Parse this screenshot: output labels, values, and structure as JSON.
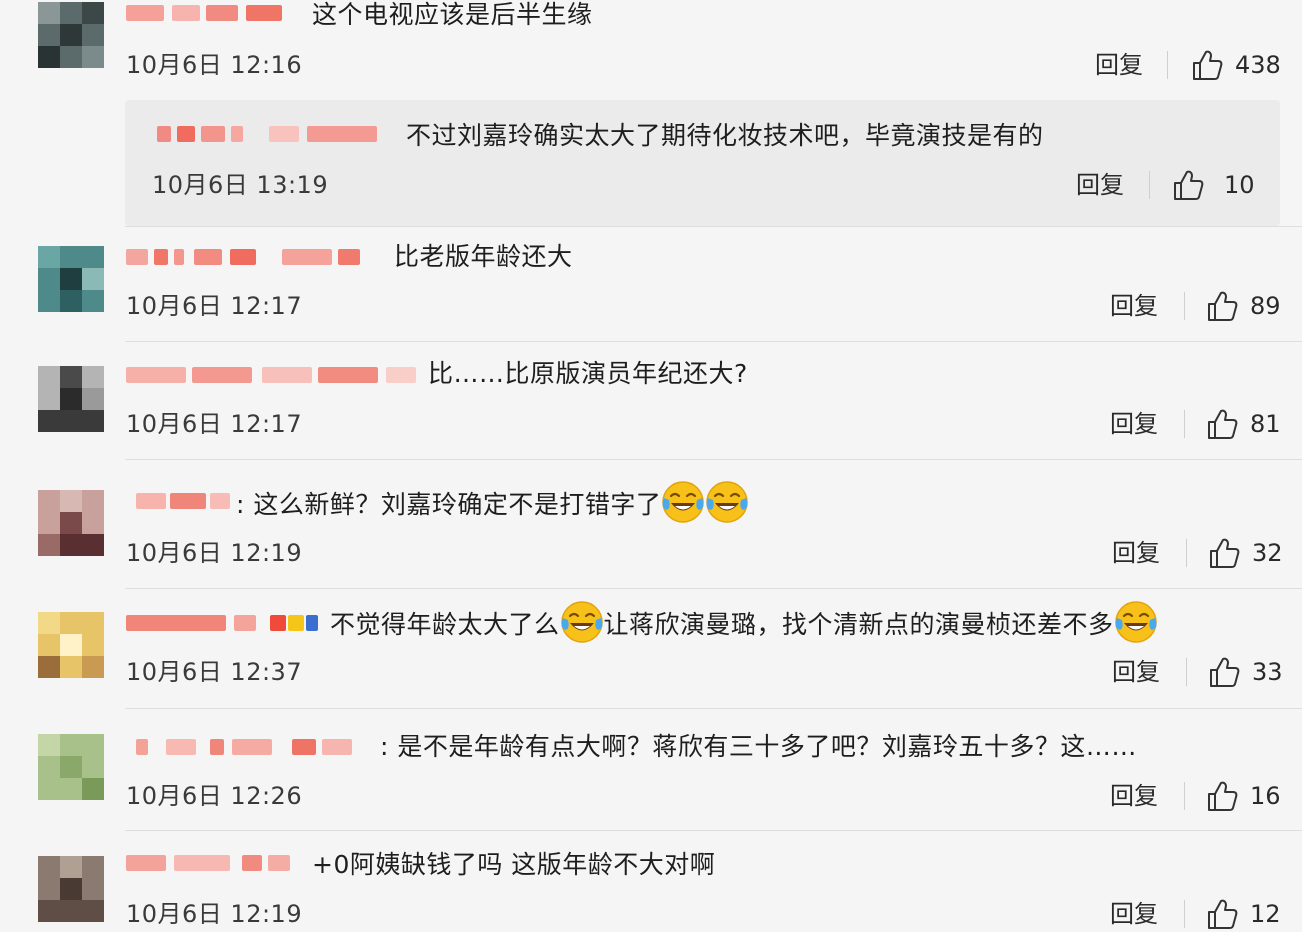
{
  "ui": {
    "reply_label": "回复"
  },
  "comments": [
    {
      "text": "这个电视应该是后半生缘",
      "time": "10月6日 12:16",
      "likes": "438"
    },
    {
      "text": "不过刘嘉玲确实太大了期待化妆技术吧，毕竟演技是有的",
      "time": "10月6日 13:19",
      "likes": "10"
    },
    {
      "text": "比老版年龄还大",
      "time": "10月6日 12:17",
      "likes": "89"
    },
    {
      "text": "比……比原版演员年纪还大?",
      "time": "10月6日 12:17",
      "likes": "81"
    },
    {
      "prefix": ":",
      "text": "这么新鲜？刘嘉玲确定不是打错字了",
      "time": "10月6日 12:19",
      "likes": "32"
    },
    {
      "text": "不觉得年龄太大了么",
      "text2": "让蒋欣演曼璐，找个清新点的演曼桢还差不多",
      "time": "10月6日 12:37",
      "likes": "33"
    },
    {
      "prefix": ":",
      "text": "是不是年龄有点大啊？蒋欣有三十多了吧？刘嘉玲五十多？这……",
      "time": "10月6日 12:26",
      "likes": "16"
    },
    {
      "text": "+0阿姨缺钱了吗 这版年龄不大对啊",
      "time": "10月6日 12:19",
      "likes": "12"
    }
  ],
  "icons": {
    "like": "thumbs-up-icon",
    "emoji": "tears-of-joy-emoji"
  },
  "colors": {
    "background": "#f5f5f6",
    "reply_box": "#ebebec",
    "blurred_nick": "#f08070"
  }
}
